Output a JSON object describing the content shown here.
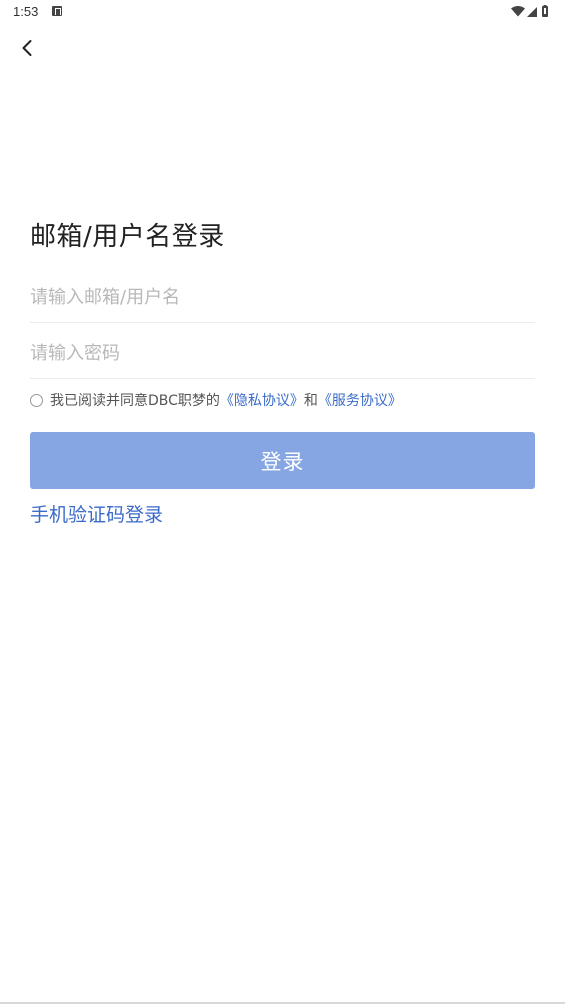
{
  "status_bar": {
    "time": "1:53",
    "icons": [
      "notification-a-icon",
      "wifi-icon",
      "cell-signal-icon",
      "battery-icon"
    ]
  },
  "nav": {
    "back_icon": "chevron-left-icon"
  },
  "login": {
    "title": "邮箱/用户名登录",
    "username_placeholder": "请输入邮箱/用户名",
    "username_value": "",
    "password_placeholder": "请输入密码",
    "password_value": "",
    "agreement": {
      "checked": false,
      "prefix": "我已阅读并同意DBC职梦的",
      "privacy_link": "《隐私协议》",
      "conjunction": "和",
      "service_link": "《服务协议》"
    },
    "submit_label": "登录",
    "alt_login_label": "手机验证码登录"
  },
  "colors": {
    "accent": "#3a6bc9",
    "button_disabled": "#86a6e3",
    "placeholder": "#b8b8b8",
    "divider": "#ececec"
  }
}
